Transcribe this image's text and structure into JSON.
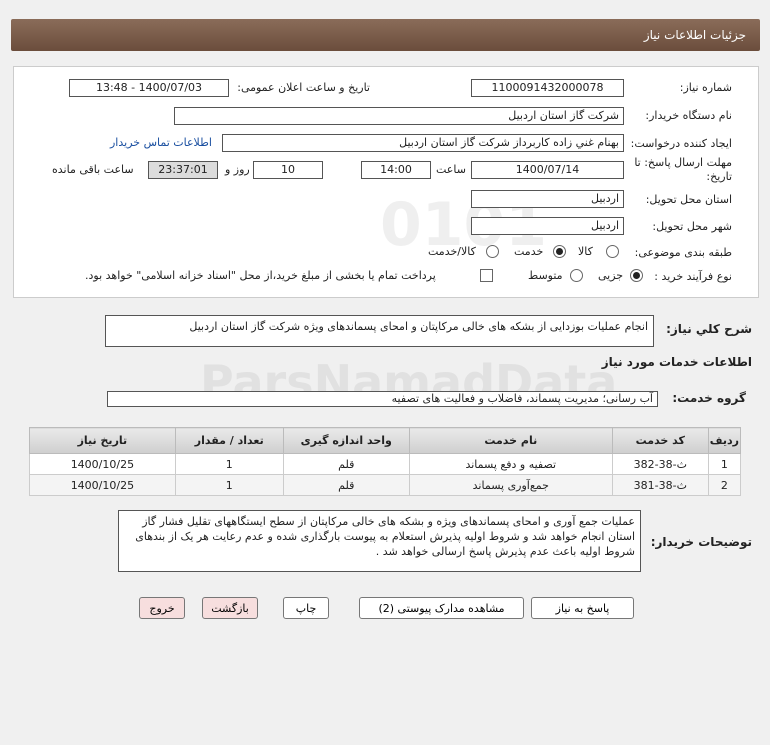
{
  "page_title": "جزئیات اطلاعات نیاز",
  "form": {
    "need_number_label": "شماره نیاز:",
    "need_number": "1100091432000078",
    "announce_label": "تاریخ و ساعت اعلان عمومی:",
    "announce_value": "1400/07/03 - 13:48",
    "buyer_label": "نام دستگاه خریدار:",
    "buyer": "شرکت گاز استان اردبیل",
    "creator_label": "ایجاد کننده درخواست:",
    "creator": "بهنام  غني زاده  کاربرداز  شرکت گاز استان اردبیل",
    "contact_link": "اطلاعات تماس خریدار",
    "deadline_label": "مهلت ارسال پاسخ: تا تاریخ:",
    "deadline_date": "1400/07/14",
    "time_label": "ساعت",
    "deadline_time": "14:00",
    "days_value": "10",
    "days_label": "روز و",
    "remaining_time": "23:37:01",
    "remaining_label": "ساعت باقی مانده",
    "province_label": "استان محل تحویل:",
    "province": "اردبیل",
    "city_label": "شهر محل تحویل:",
    "city": "اردبیل",
    "category_label": "طبقه بندی موضوعی:",
    "category_options": [
      "کالا",
      "خدمت",
      "کالا/خدمت"
    ],
    "category_selected": "خدمت",
    "process_label": "نوع فرآیند خرید :",
    "process_options": [
      "جزیی",
      "متوسط"
    ],
    "process_selected": "جزیی",
    "payment_note": "پرداخت تمام یا بخشی از مبلغ خرید،از محل \"اسناد خزانه اسلامی\" خواهد بود."
  },
  "summary": {
    "label": "شرح کلي نياز:",
    "text": "انجام عملیات بوزدایی از بشکه های خالی مرکاپتان و امحای پسماندهای ویژه شرکت گاز استان اردبیل"
  },
  "services": {
    "section_title": "اطلاعات خدمات مورد نیاز",
    "group_label": "گروه خدمت:",
    "group_value": "آب رسانی؛ مدیریت پسماند، فاضلاب و فعالیت های تصفیه",
    "columns": [
      "ردیف",
      "کد خدمت",
      "نام خدمت",
      "واحد اندازه گیری",
      "تعداد / مقدار",
      "تاریخ نیاز"
    ],
    "rows": [
      [
        "1",
        "ث-38-382",
        "تصفیه و دفع پسماند",
        "قلم",
        "1",
        "1400/10/25"
      ],
      [
        "2",
        "ث-38-381",
        "جمع‌آوری پسماند",
        "قلم",
        "1",
        "1400/10/25"
      ]
    ]
  },
  "buyer_notes": {
    "label": "توضیحات خریدار:",
    "text": "عملیات جمع آوری و امحای پسماندهای ویژه و بشکه های خالی مرکاپتان از سطح ایستگاههای تقلیل فشار گاز  استان انجام خواهد شد و شروط اولیه پذیرش استعلام به پیوست بارگذاری شده و عدم رعایت هر یک از بندهای شروط اولیه باعث عدم پذیرش پاسخ ارسالی خواهد شد ."
  },
  "buttons": {
    "reply": "پاسخ به نیاز",
    "attachments": "مشاهده مدارک پیوستی (2)",
    "print": "چاپ",
    "back": "بازگشت",
    "exit": "خروج"
  },
  "watermark": {
    "digits": "0101",
    "brand": "ParsNamadData"
  }
}
